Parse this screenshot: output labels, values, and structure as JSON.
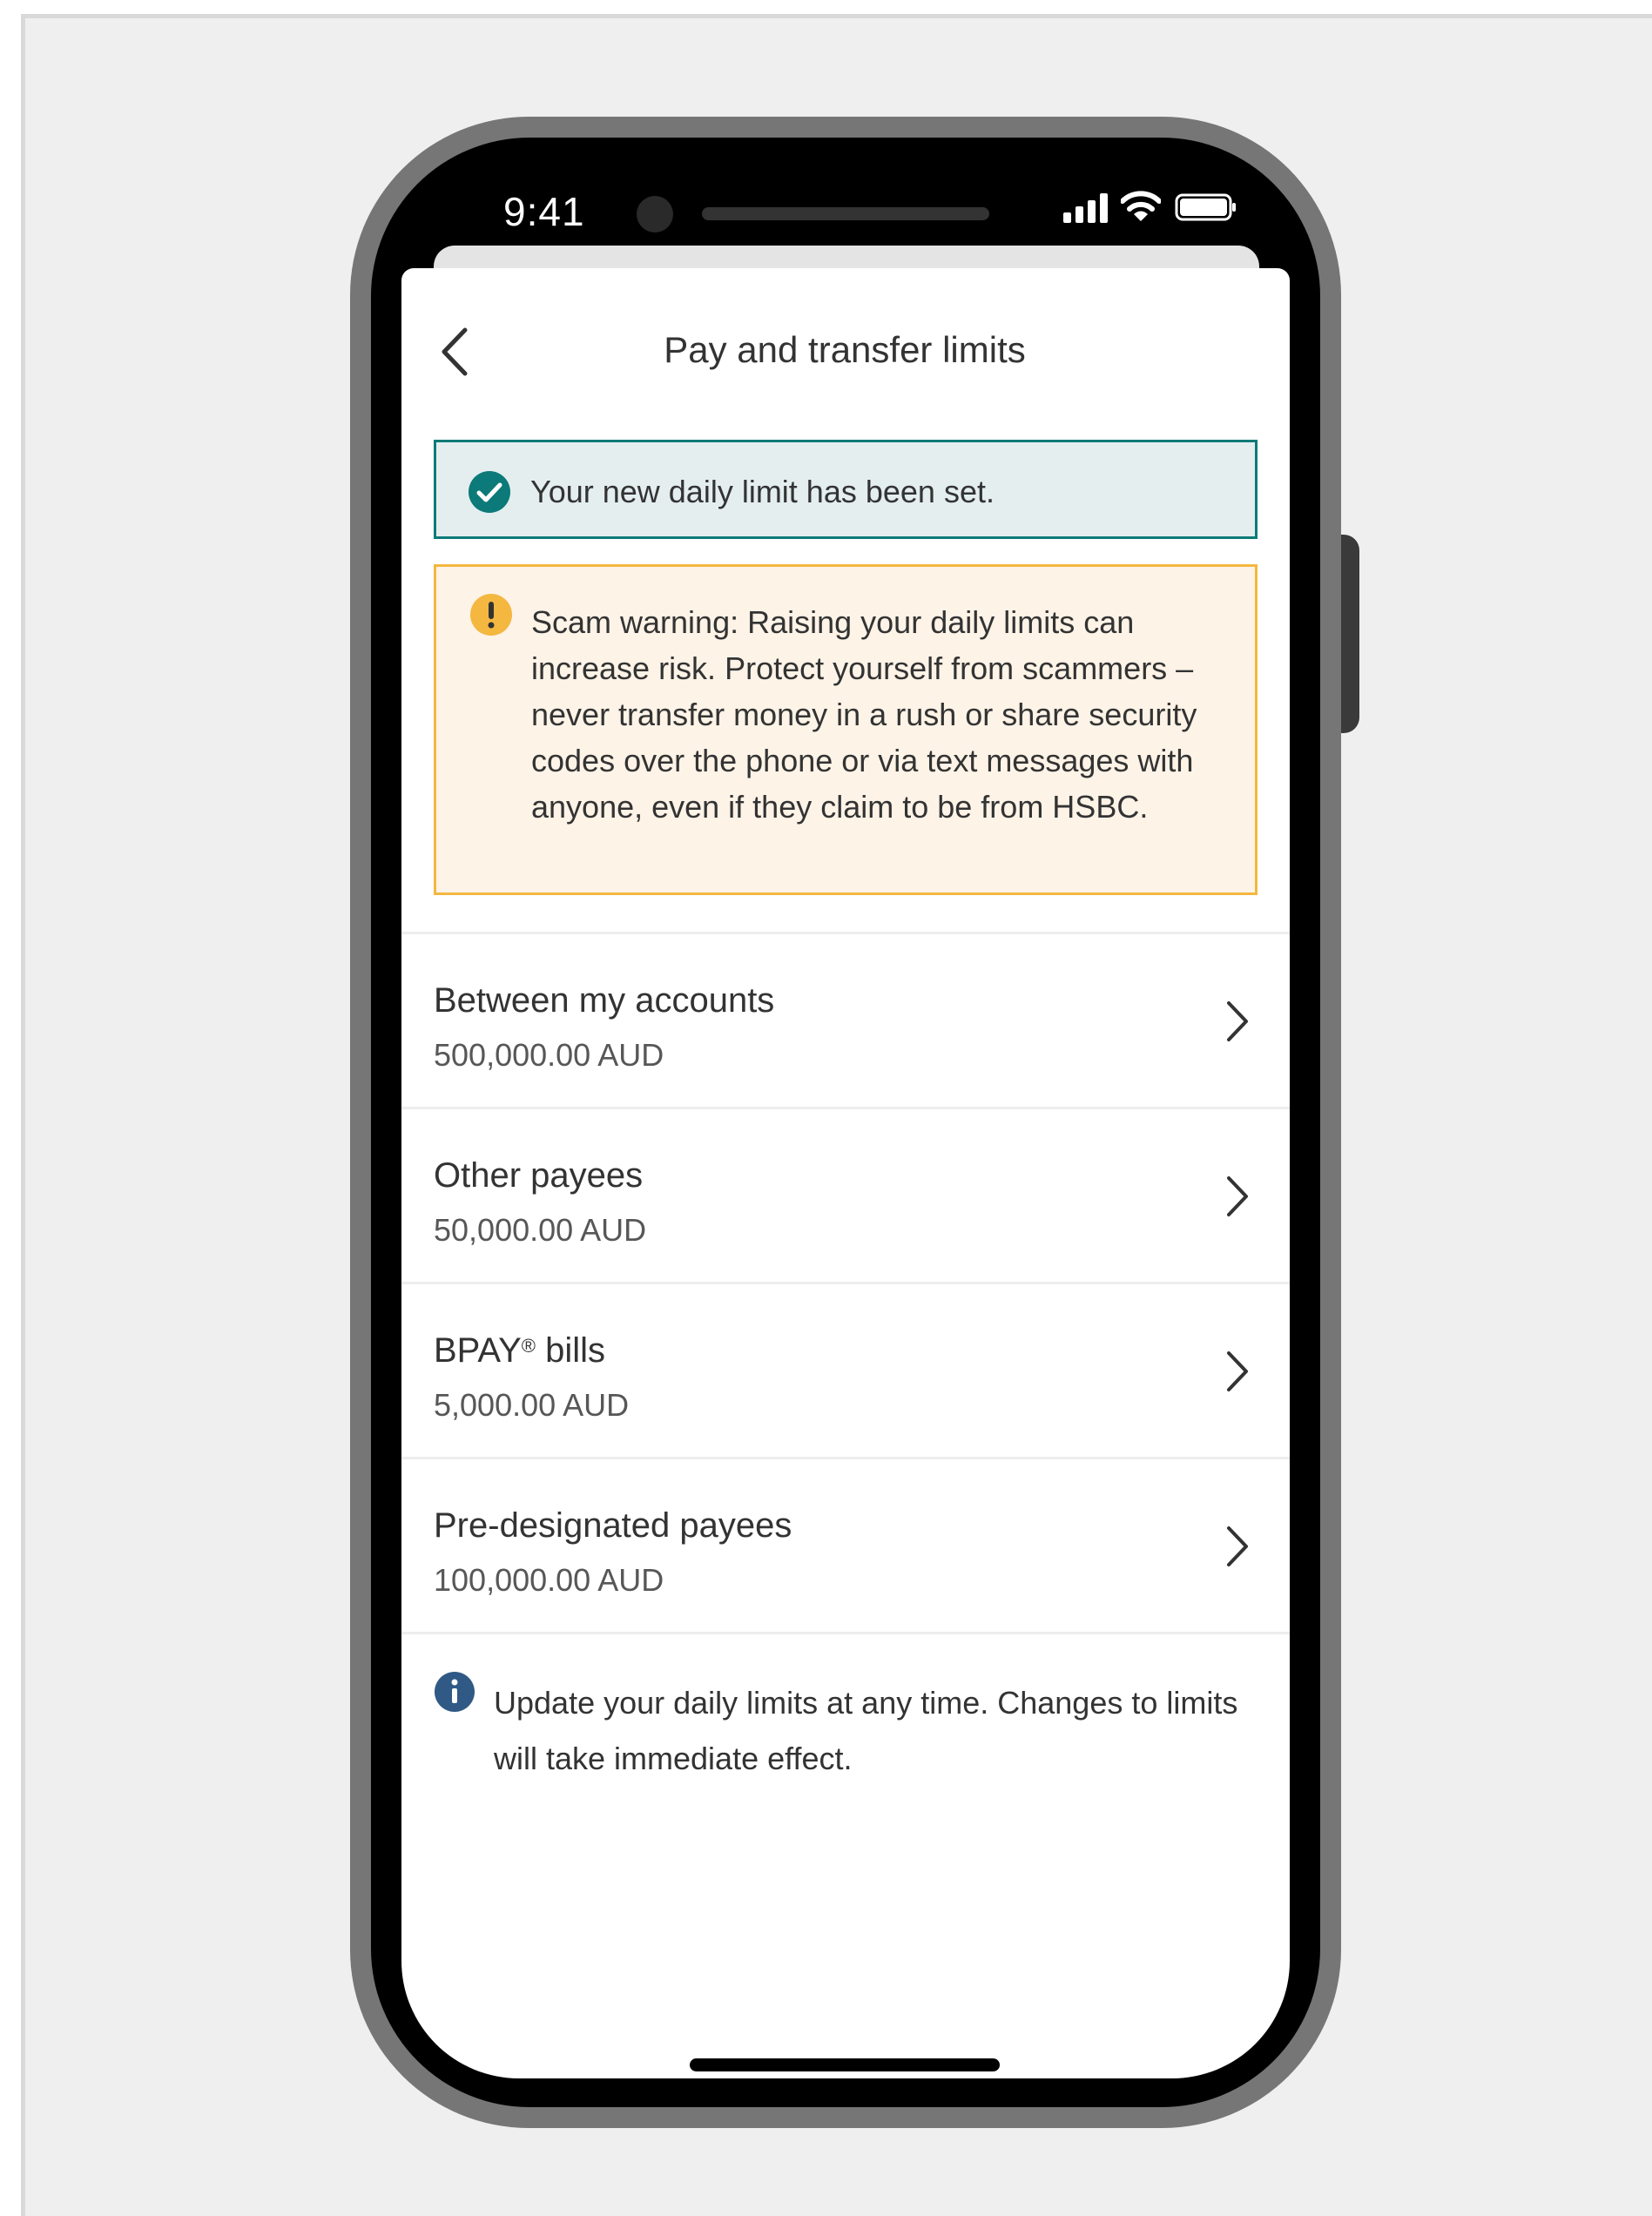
{
  "status_bar": {
    "time": "9:41"
  },
  "header": {
    "title": "Pay and transfer limits",
    "back_icon": "chevron-left-icon"
  },
  "success_banner": {
    "icon": "check-circle-icon",
    "message": "Your new daily limit has been set.",
    "color": "#0b7a78",
    "background": "#e4eeef"
  },
  "scam_warning": {
    "icon": "exclamation-circle-icon",
    "message": "Scam warning: Raising your daily limits can increase risk. Protect yourself from scammers – never transfer money in a rush or share security codes over the phone or via text messages with anyone, even if they claim to be from HSBC.",
    "color": "#f4b740",
    "background": "#fdf3e7"
  },
  "limits": [
    {
      "label": "Between my accounts",
      "value": "500,000.00 AUD"
    },
    {
      "label": "Other payees",
      "value": "50,000.00 AUD"
    },
    {
      "label": "BPAY",
      "label_mark": "®",
      "label_suffix": " bills",
      "value": "5,000.00 AUD"
    },
    {
      "label": "Pre-designated payees",
      "value": "100,000.00 AUD"
    }
  ],
  "info_note": {
    "icon": "info-circle-icon",
    "message": "Update your daily limits at any time. Changes to limits will take immediate effect.",
    "color": "#305a85"
  }
}
